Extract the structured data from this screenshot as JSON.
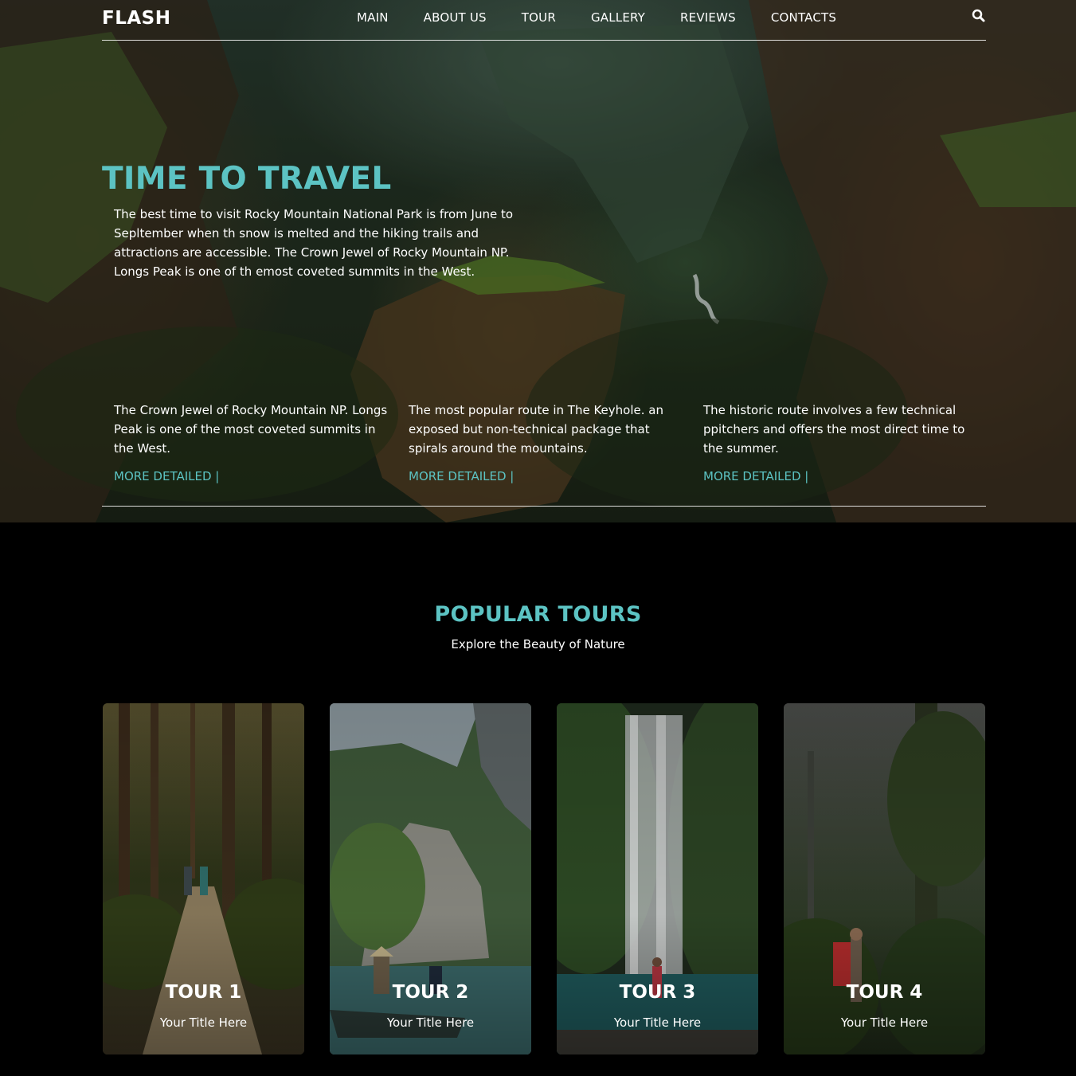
{
  "brand": "FLASH",
  "nav": {
    "items": [
      "MAIN",
      "ABOUT US",
      "TOUR",
      "GALLERY",
      "REVIEWS",
      "CONTACTS"
    ],
    "search_icon": "search-icon"
  },
  "hero": {
    "title": "TIME TO TRAVEL",
    "text": "The best time to visit Rocky Mountain National Park is from June to Sepltember when th snow is melted and the hiking trails and attractions are accessible. The Crown Jewel of Rocky Mountain NP. Longs Peak is one of th emost coveted summits in the West.",
    "columns": [
      {
        "text": "The Crown Jewel of Rocky Mountain NP. Longs Peak is one of the most coveted summits in the West.",
        "link": "MORE DETAILED |"
      },
      {
        "text": "The most popular route in The Keyhole. an exposed but non-technical package that spirals around the mountains.",
        "link": "MORE DETAILED |"
      },
      {
        "text": "The historic route involves a few technical ppitchers and offers the most direct time to the summer.",
        "link": "MORE DETAILED |"
      }
    ]
  },
  "tours": {
    "title": "POPULAR TOURS",
    "subtitle": "Explore the Beauty of Nature",
    "cards": [
      {
        "name": "TOUR 1",
        "subtitle": "Your Title Here"
      },
      {
        "name": "TOUR 2",
        "subtitle": "Your Title Here"
      },
      {
        "name": "TOUR 3",
        "subtitle": "Your Title Here"
      },
      {
        "name": "TOUR 4",
        "subtitle": "Your Title Here"
      }
    ]
  },
  "colors": {
    "accent": "#5cc3c3",
    "background": "#000000",
    "text": "#ffffff"
  }
}
